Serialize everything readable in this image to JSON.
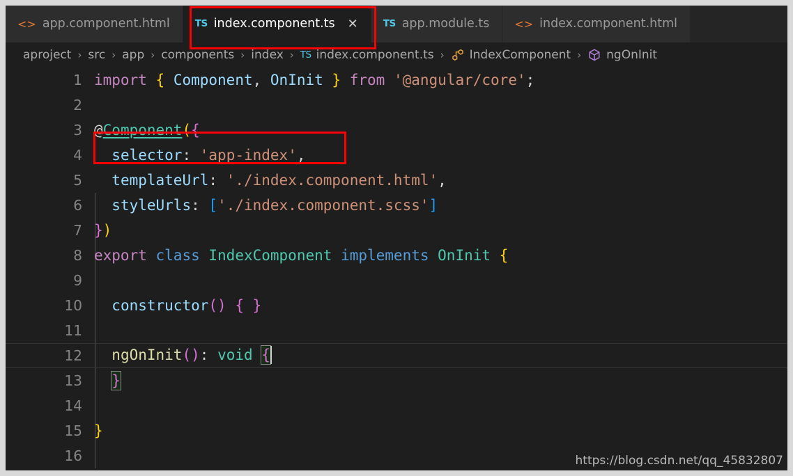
{
  "window": {
    "editor_background": "#1e1e1e",
    "tabbar_background": "#252526",
    "annotation_color": "#ff0000"
  },
  "tabs": [
    {
      "label": "app.component.html",
      "icon": "html-angle-brackets-icon",
      "icon_text": "<>",
      "active": false,
      "closable": false
    },
    {
      "label": "index.component.ts",
      "icon": "typescript-icon",
      "icon_text": "TS",
      "active": true,
      "closable": true,
      "close_label": "✕"
    },
    {
      "label": "app.module.ts",
      "icon": "typescript-icon",
      "icon_text": "TS",
      "active": false,
      "closable": false
    },
    {
      "label": "index.component.html",
      "icon": "html-angle-brackets-icon",
      "icon_text": "<>",
      "active": false,
      "closable": false
    }
  ],
  "breadcrumb": {
    "separator": "›",
    "items": [
      {
        "label": "aproject",
        "icon": null
      },
      {
        "label": "src",
        "icon": null
      },
      {
        "label": "app",
        "icon": null
      },
      {
        "label": "components",
        "icon": null
      },
      {
        "label": "index",
        "icon": null
      },
      {
        "label": "index.component.ts",
        "icon": "typescript-icon",
        "icon_text": "TS"
      },
      {
        "label": "IndexComponent",
        "icon": "class-symbol-icon"
      },
      {
        "label": "ngOnInit",
        "icon": "method-symbol-icon"
      }
    ]
  },
  "editor": {
    "language": "typescript",
    "current_line": 12,
    "line_numbers": [
      1,
      2,
      3,
      4,
      5,
      6,
      7,
      8,
      9,
      10,
      11,
      12,
      13,
      14,
      15,
      16
    ],
    "lines": [
      {
        "n": 1,
        "text": "import { Component, OnInit } from '@angular/core';"
      },
      {
        "n": 2,
        "text": ""
      },
      {
        "n": 3,
        "text": "@Component({"
      },
      {
        "n": 4,
        "text": "  selector: 'app-index',"
      },
      {
        "n": 5,
        "text": "  templateUrl: './index.component.html',"
      },
      {
        "n": 6,
        "text": "  styleUrls: ['./index.component.scss']"
      },
      {
        "n": 7,
        "text": "})"
      },
      {
        "n": 8,
        "text": "export class IndexComponent implements OnInit {"
      },
      {
        "n": 9,
        "text": ""
      },
      {
        "n": 10,
        "text": "  constructor() { }"
      },
      {
        "n": 11,
        "text": ""
      },
      {
        "n": 12,
        "text": "  ngOnInit(): void {"
      },
      {
        "n": 13,
        "text": "  }"
      },
      {
        "n": 14,
        "text": ""
      },
      {
        "n": 15,
        "text": "}"
      },
      {
        "n": 16,
        "text": ""
      }
    ]
  },
  "watermark": {
    "text": "https://blog.csdn.net/qq_45832807"
  }
}
